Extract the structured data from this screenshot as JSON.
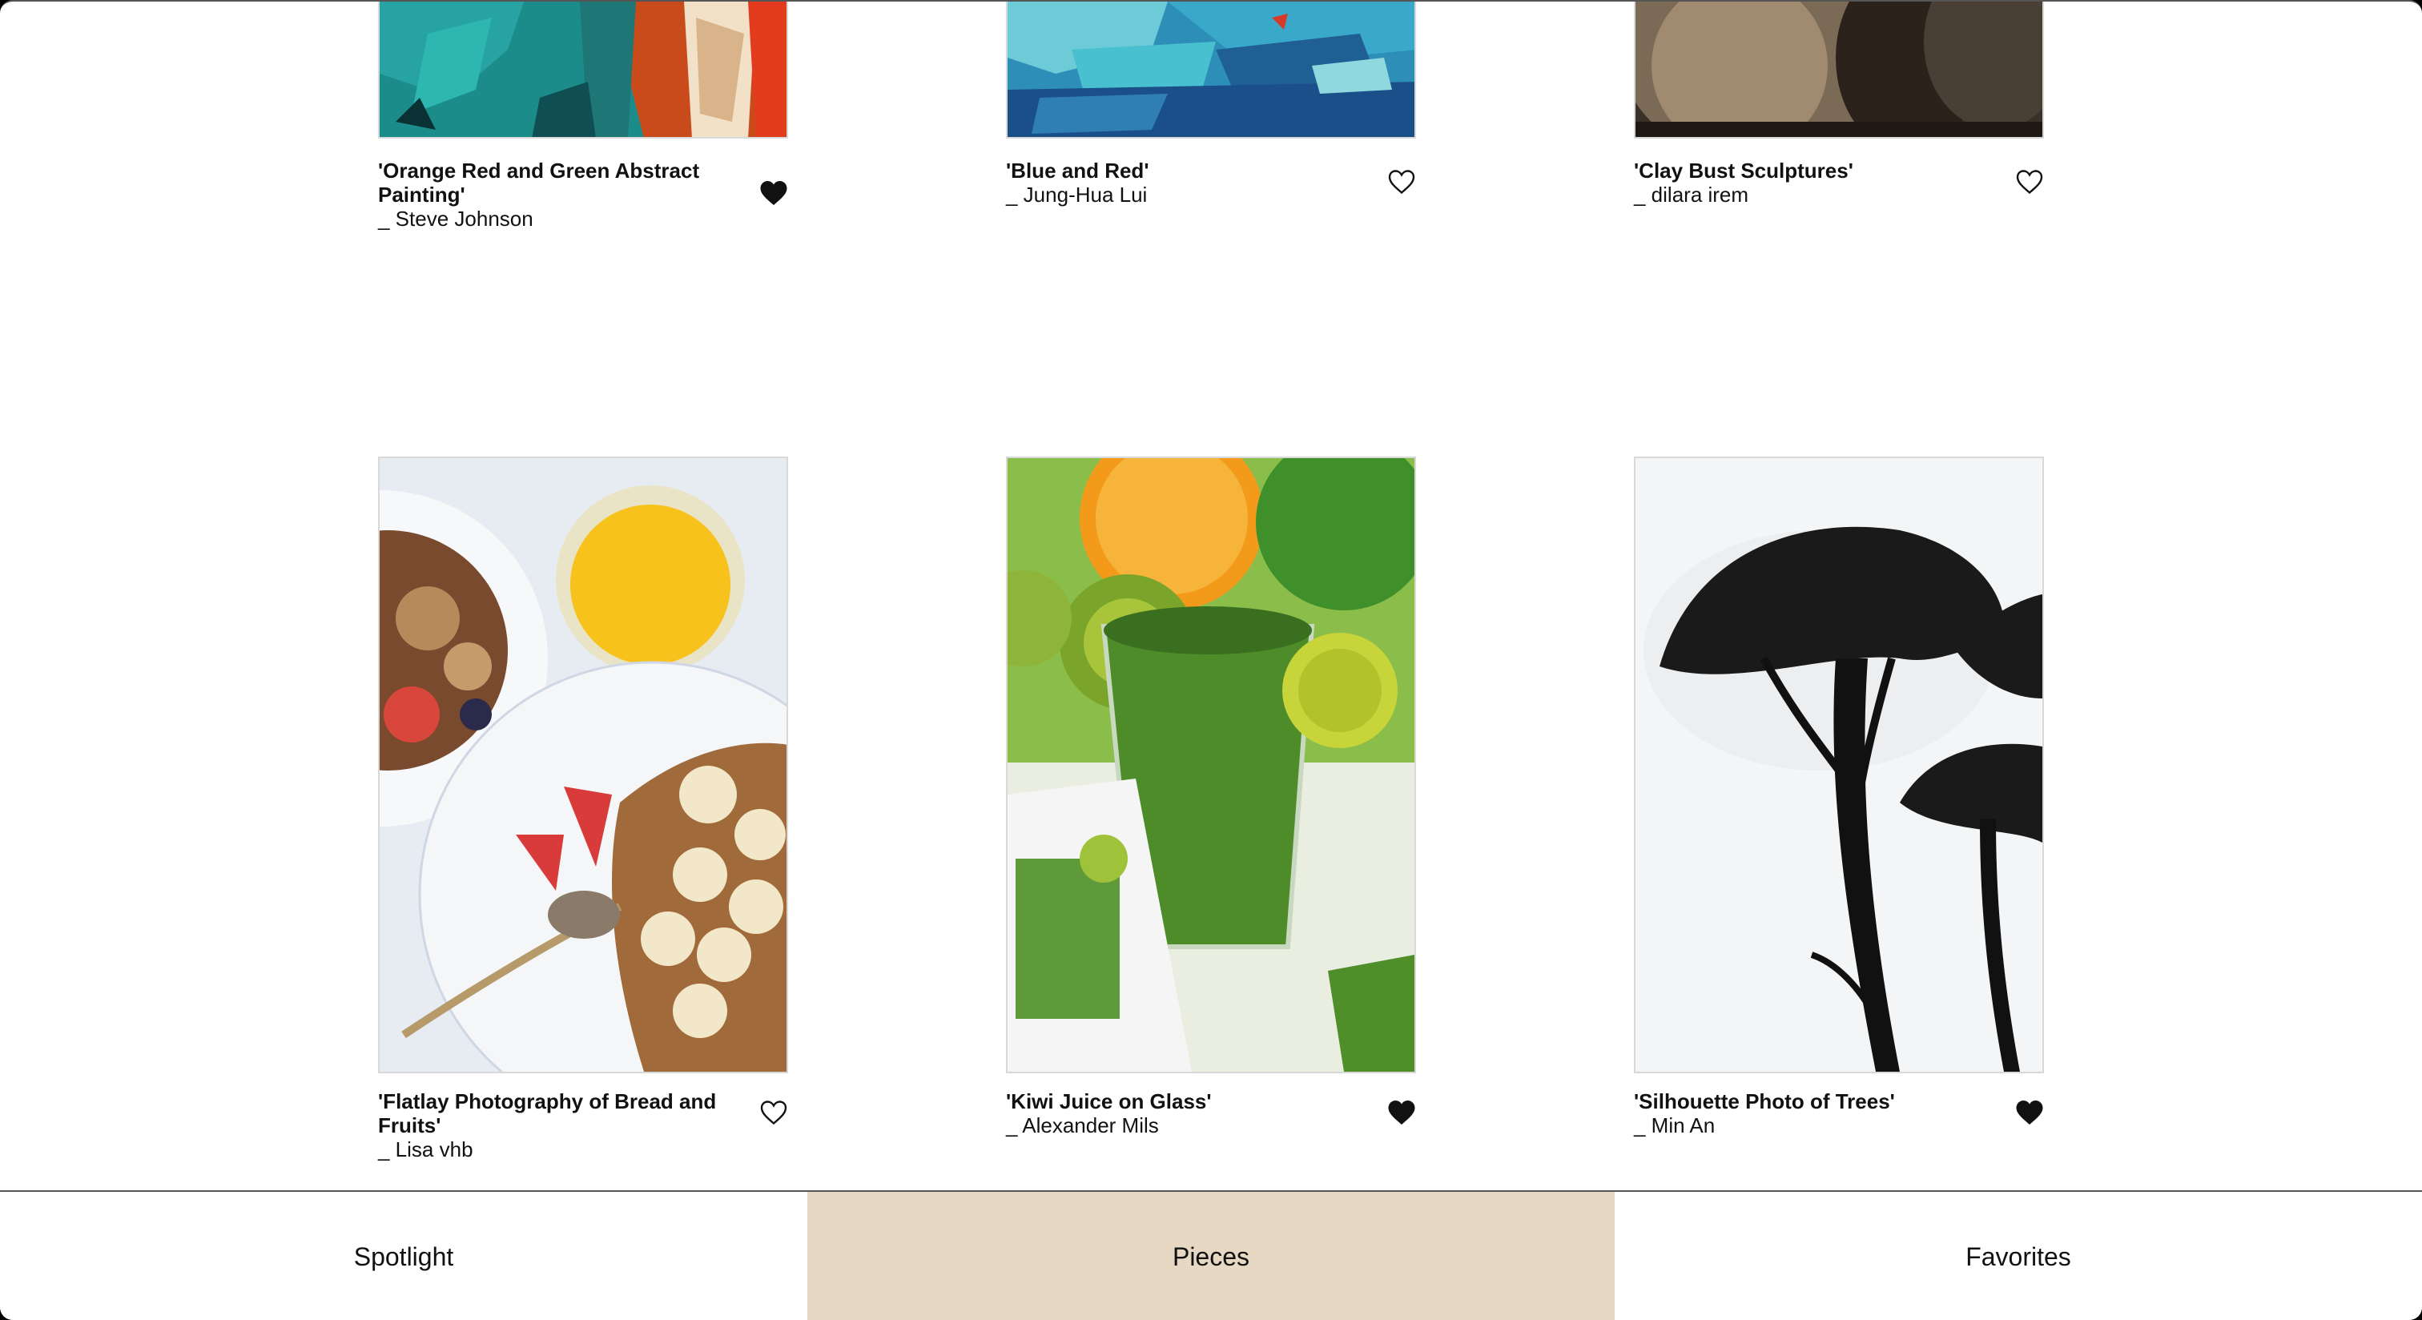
{
  "gallery": {
    "items": [
      {
        "title": "'Orange Red and Green Abstract Painting'",
        "artist": "_ Steve Johnson",
        "favorited": true
      },
      {
        "title": "'Blue and Red'",
        "artist": "_ Jung-Hua Lui",
        "favorited": false
      },
      {
        "title": "'Clay Bust Sculptures'",
        "artist": "_ dilara irem",
        "favorited": false
      },
      {
        "title": "'Flatlay Photography of Bread and Fruits'",
        "artist": "_ Lisa vhb",
        "favorited": false
      },
      {
        "title": "'Kiwi Juice on Glass'",
        "artist": "_ Alexander Mils",
        "favorited": true
      },
      {
        "title": "'Silhouette Photo of Trees'",
        "artist": "_ Min An",
        "favorited": true
      }
    ]
  },
  "tabs": [
    {
      "label": "Spotlight",
      "active": false
    },
    {
      "label": "Pieces",
      "active": true
    },
    {
      "label": "Favorites",
      "active": false
    }
  ],
  "colors": {
    "active_tab": "#e7d8c4",
    "heart": "#111111"
  }
}
